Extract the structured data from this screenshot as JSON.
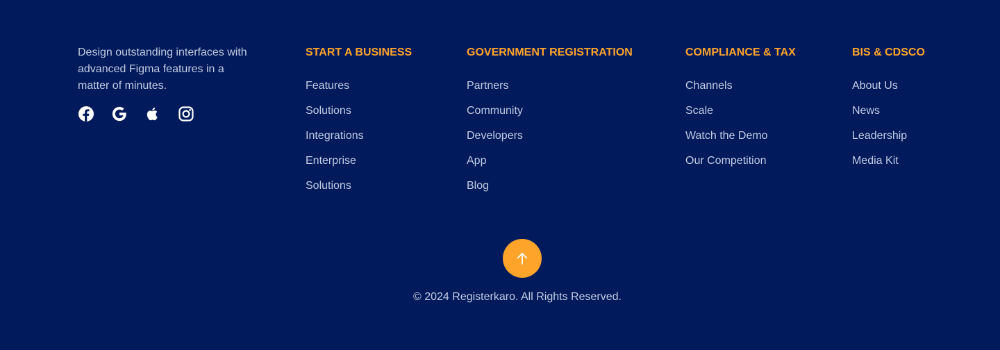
{
  "brand": {
    "tagline": "Design outstanding interfaces with advanced Figma features in a matter of minutes.",
    "socials": [
      {
        "name": "facebook-icon"
      },
      {
        "name": "google-icon"
      },
      {
        "name": "apple-icon"
      },
      {
        "name": "instagram-icon"
      }
    ]
  },
  "columns": [
    {
      "heading": "START A BUSINESS",
      "links": [
        "Features",
        "Solutions",
        "Integrations",
        "Enterprise",
        "Solutions"
      ]
    },
    {
      "heading": "GOVERNMENT REGISTRATION",
      "links": [
        "Partners",
        "Community",
        "Developers",
        "App",
        "Blog"
      ]
    },
    {
      "heading": "COMPLIANCE & TAX",
      "links": [
        "Channels",
        "Scale",
        "Watch the Demo",
        "Our Competition"
      ]
    },
    {
      "heading": "BIS & CDSCO",
      "links": [
        "About Us",
        "News",
        "Leadership",
        "Media Kit"
      ]
    }
  ],
  "scroll_top": {
    "icon": "arrow-up-icon"
  },
  "copyright": "© 2024 Registerkaro. All Rights Reserved.",
  "colors": {
    "background": "#001a5c",
    "accent": "#ffa42b",
    "text": "#c3cbe0"
  }
}
